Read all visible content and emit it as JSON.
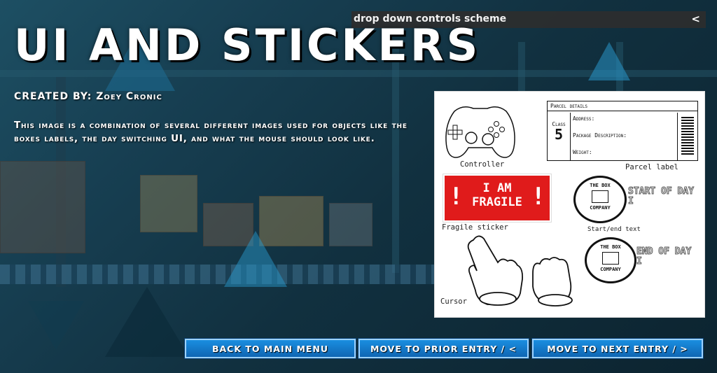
{
  "dropdown": {
    "label": "drop down controls scheme",
    "toggle": "<"
  },
  "header": {
    "title": "UI AND STICKERS"
  },
  "info": {
    "author": "CREATED BY: Zoey Cronic",
    "description": "This image is a combination of several different images used for objects like the boxes labels, the day switching UI, and what the mouse should look like."
  },
  "preview": {
    "controller_caption": "Controller",
    "parcel": {
      "header": "Parcel details",
      "class_label": "Class",
      "class_value": "5",
      "address_label": "Address:",
      "package_desc_label": "Package Description:",
      "weight_label": "Weight:",
      "caption": "Parcel label"
    },
    "fragile": {
      "line1": "I AM",
      "line2": "FRAGILE",
      "caption": "Fragile sticker"
    },
    "day": {
      "logo_line1": "THE BOX",
      "logo_line2": "COMPANY",
      "start_text": "START OF DAY I",
      "end_text": "END OF DAY I",
      "caption": "Start/end text"
    },
    "cursor_caption": "Cursor"
  },
  "nav": {
    "back": "BACK TO MAIN MENU",
    "prior": "MOVE TO PRIOR ENTRY / <",
    "next": "MOVE TO NEXT ENTRY / >"
  },
  "colors": {
    "accent": "#1a8ee0",
    "fragile_red": "#e01b1b"
  }
}
